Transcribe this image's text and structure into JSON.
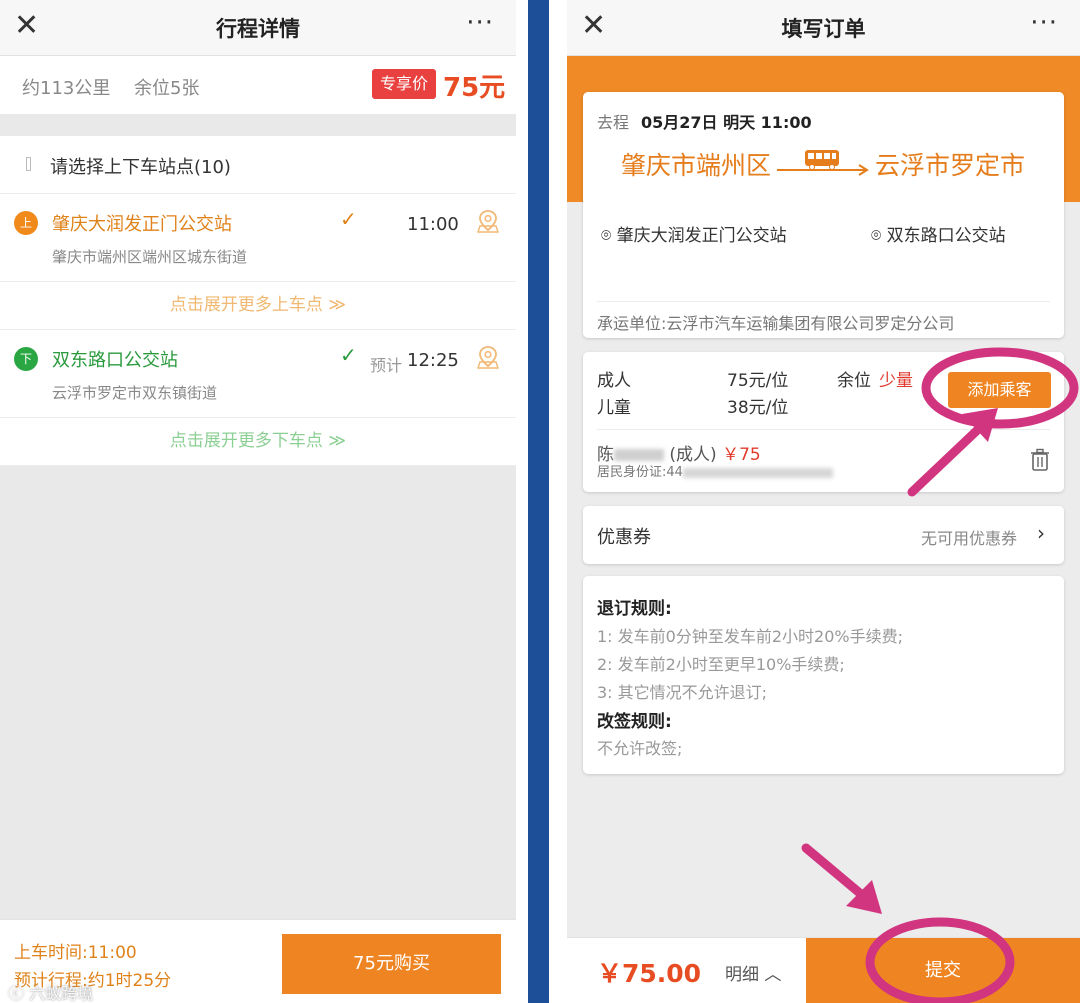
{
  "left": {
    "nav": {
      "close": "✕",
      "title": "行程详情",
      "more": "···"
    },
    "info": {
      "distance": "约113公里",
      "seats": "余位5张",
      "badge": "专享价",
      "price": "75元"
    },
    "stations": {
      "header": "请选择上下车站点(10)",
      "boarding": {
        "marker": "上",
        "name": "肇庆大润发正门公交站",
        "check": "✓",
        "time": "11:00",
        "address": "肇庆市端州区端州区城东街道",
        "pin_icon": "map-pin-icon"
      },
      "expand_boarding": "点击展开更多上车点 ≫",
      "alighting": {
        "marker": "下",
        "name": "双东路口公交站",
        "check": "✓",
        "prefix": "预计",
        "time": "12:25",
        "address": "云浮市罗定市双东镇街道",
        "pin_icon": "map-pin-icon"
      },
      "expand_alighting": "点击展开更多下车点 ≫"
    },
    "footer": {
      "departure": "上车时间:11:00",
      "duration": "预计行程:约1时25分",
      "buy": "75元购买",
      "watermark": "ⓒ 六蚁跨境"
    }
  },
  "right": {
    "nav": {
      "close": "✕",
      "title": "填写订单",
      "more": "···"
    },
    "trip": {
      "direction": "去程",
      "date": "05月27日 明天 11:00",
      "from_city": "肇庆市端州区",
      "to_city": "云浮市罗定市",
      "from_station": "肇庆大润发正门公交站",
      "to_station": "双东路口公交站",
      "carrier": "承运单位:云浮市汽车运输集团有限公司罗定分公司"
    },
    "passengers": {
      "adult_label": "成人",
      "adult_price": "75元/位",
      "child_label": "儿童",
      "child_price": "38元/位",
      "seat_label": "余位",
      "seat_value": "少量",
      "add_button": "添加乘客",
      "passenger_name": "陈",
      "passenger_type": "(成人)",
      "passenger_price": "￥75",
      "id_label": "居民身份证:44",
      "trash_icon": "trash-icon"
    },
    "coupon": {
      "label": "优惠券",
      "value": "无可用优惠券",
      "chevron": "›"
    },
    "rules": {
      "refund_title": "退订规则:",
      "refund_items": [
        "1:  发车前0分钟至发车前2小时20%手续费;",
        "2:  发车前2小时至更早10%手续费;",
        "3:  其它情况不允许退订;"
      ],
      "change_title": "改签规则:",
      "change_text": "不允许改签;"
    },
    "footer": {
      "total": "￥75.00",
      "detail": "明细 ︿",
      "submit": "提交"
    }
  },
  "colors": {
    "accent": "#ef8522",
    "price_red": "#e74c22",
    "boarding": "#f08a1b",
    "alighting": "#2aa742",
    "divider_blue": "#1d4f99",
    "annotation": "#d1357f"
  }
}
